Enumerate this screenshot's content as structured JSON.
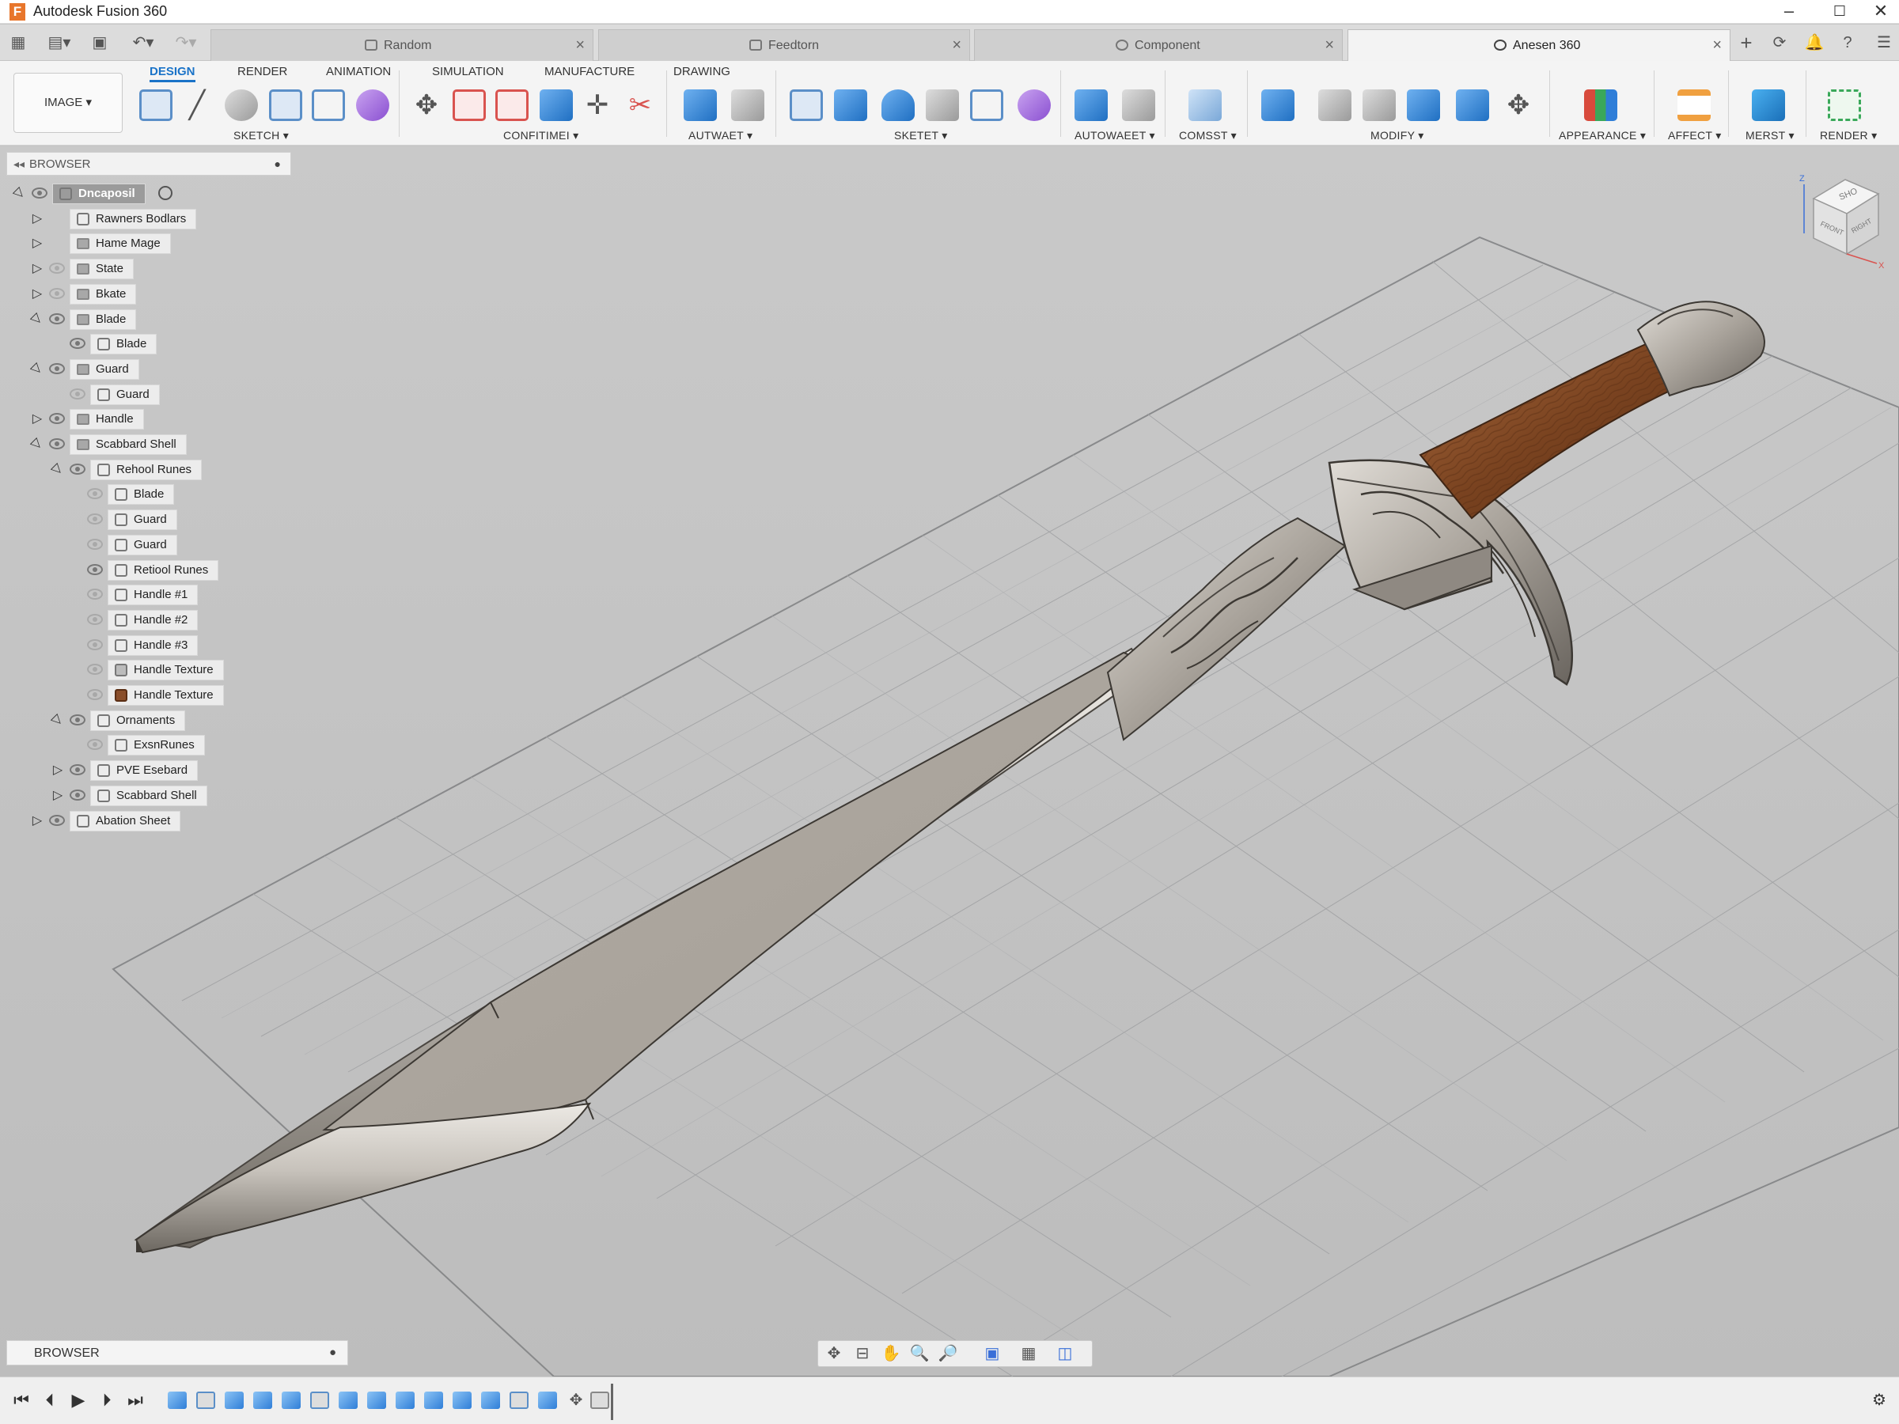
{
  "app": {
    "title": "Autodesk Fusion 360",
    "logo": "F"
  },
  "window_controls": {
    "minimize_icon": "minimize-icon",
    "maximize_icon": "maximize-icon",
    "close_icon": "close-icon"
  },
  "tabs": [
    {
      "label": "Random",
      "active": false
    },
    {
      "label": "Feedtorn",
      "active": false
    },
    {
      "label": "Component",
      "active": false
    },
    {
      "label": "Anesen 360",
      "active": true
    }
  ],
  "ribbon": {
    "workspace": "IMAGE",
    "workspace_tabs": [
      "DESIGN",
      "RENDER",
      "ANIMATION",
      "SIMULATION",
      "MANUFACTURE",
      "DRAWING"
    ],
    "active_tab": "DESIGN",
    "groups": [
      "SKETCH",
      "CONFITIMEI",
      "AUTWAET",
      "SKETET",
      "AUTOWAEET",
      "COMSST",
      "MODIFY",
      "APPEARANCE",
      "AFFECT",
      "MERST",
      "RENDER"
    ]
  },
  "browser": {
    "title": "BROWSER",
    "tree": [
      {
        "label": "Dncaposil",
        "depth": 0,
        "twisty": "open",
        "eye": true,
        "icon": "component",
        "root": true
      },
      {
        "label": "Rawners Bodlars",
        "depth": 1,
        "twisty": "closed",
        "eye": null,
        "icon": "settings"
      },
      {
        "label": "Hame Mage",
        "depth": 1,
        "twisty": "closed",
        "eye": null,
        "icon": "folder"
      },
      {
        "label": "State",
        "depth": 1,
        "twisty": "closed",
        "eye": false,
        "icon": "folder"
      },
      {
        "label": "Bkate",
        "depth": 1,
        "twisty": "closed",
        "eye": false,
        "icon": "folder"
      },
      {
        "label": "Blade",
        "depth": 1,
        "twisty": "open",
        "eye": true,
        "icon": "folder"
      },
      {
        "label": "Blade",
        "depth": 2,
        "twisty": null,
        "eye": true,
        "icon": "body"
      },
      {
        "label": "Guard",
        "depth": 1,
        "twisty": "open",
        "eye": true,
        "icon": "folder"
      },
      {
        "label": "Guard",
        "depth": 2,
        "twisty": null,
        "eye": false,
        "icon": "body"
      },
      {
        "label": "Handle",
        "depth": 1,
        "twisty": "closed",
        "eye": true,
        "icon": "folder"
      },
      {
        "label": "Scabbard Shell",
        "depth": 1,
        "twisty": "open",
        "eye": true,
        "icon": "folder"
      },
      {
        "label": "Rehool Runes",
        "depth": 2,
        "twisty": "open",
        "eye": true,
        "icon": "component"
      },
      {
        "label": "Blade",
        "depth": 3,
        "twisty": null,
        "eye": false,
        "icon": "body"
      },
      {
        "label": "Guard",
        "depth": 3,
        "twisty": null,
        "eye": false,
        "icon": "body"
      },
      {
        "label": "Guard",
        "depth": 3,
        "twisty": null,
        "eye": false,
        "icon": "body"
      },
      {
        "label": "Retiool Runes",
        "depth": 3,
        "twisty": null,
        "eye": true,
        "icon": "body"
      },
      {
        "label": "Handle #1",
        "depth": 3,
        "twisty": null,
        "eye": false,
        "icon": "body"
      },
      {
        "label": "Handle #2",
        "depth": 3,
        "twisty": null,
        "eye": false,
        "icon": "body"
      },
      {
        "label": "Handle #3",
        "depth": 3,
        "twisty": null,
        "eye": false,
        "icon": "body"
      },
      {
        "label": "Handle Texture",
        "depth": 3,
        "twisty": null,
        "eye": false,
        "icon": "texture"
      },
      {
        "label": "Handle Texture",
        "depth": 3,
        "twisty": null,
        "eye": false,
        "icon": "wood"
      },
      {
        "label": "Ornaments",
        "depth": 2,
        "twisty": "open",
        "eye": true,
        "icon": "component"
      },
      {
        "label": "ExsnRunes",
        "depth": 3,
        "twisty": null,
        "eye": false,
        "icon": "mesh"
      },
      {
        "label": "PVE Esebard",
        "depth": 2,
        "twisty": "closed",
        "eye": true,
        "icon": "component"
      },
      {
        "label": "Scabbard Shell",
        "depth": 2,
        "twisty": "closed",
        "eye": true,
        "icon": "component"
      },
      {
        "label": "Abation Sheet",
        "depth": 1,
        "twisty": "closed",
        "eye": true,
        "icon": "component"
      }
    ]
  },
  "bottom_browser": {
    "label": "BROWSER"
  },
  "viewcube": {
    "top": "SHO",
    "front": "FRONT",
    "right": "RIGHT",
    "axis_z": "Z",
    "axis_x": "X"
  },
  "colors": {
    "accent": "#1a73c8",
    "wood": "#7a4320",
    "steel": "#b8b3ab"
  }
}
